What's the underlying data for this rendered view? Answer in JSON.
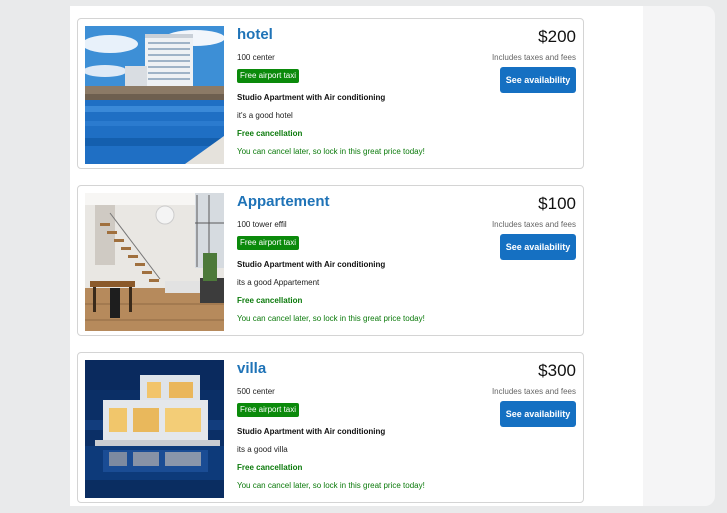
{
  "listings": [
    {
      "name": "hotel",
      "address": "100 center",
      "badge": "Free airport taxi",
      "room": "Studio Apartment with Air conditioning",
      "description": "it's a good hotel",
      "free_cancellation": "Free cancellation",
      "cancel_note": "You can cancel later, so lock in this great price today!",
      "price": "$200",
      "taxes_note": "Includes taxes and fees",
      "button": "See availability",
      "image": "hotel-pool-photo"
    },
    {
      "name": "Appartement",
      "address": "100 tower effil",
      "badge": "Free airport taxi",
      "room": "Studio Apartment with Air conditioning",
      "description": "its a good Appartement",
      "free_cancellation": "Free cancellation",
      "cancel_note": "You can cancel later, so lock in this great price today!",
      "price": "$100",
      "taxes_note": "Includes taxes and fees",
      "button": "See availability",
      "image": "apartment-interior-photo"
    },
    {
      "name": "villa",
      "address": "500 center",
      "badge": "Free airport taxi",
      "room": "Studio Apartment with Air conditioning",
      "description": "its a good villa",
      "free_cancellation": "Free cancellation",
      "cancel_note": "You can cancel later, so lock in this great price today!",
      "price": "$300",
      "taxes_note": "Includes taxes and fees",
      "button": "See availability",
      "image": "villa-night-photo"
    }
  ],
  "colors": {
    "title": "#1f73b7",
    "badge": "#0b8a0b",
    "green_text": "#0b7a0b",
    "button": "#1570c2"
  }
}
